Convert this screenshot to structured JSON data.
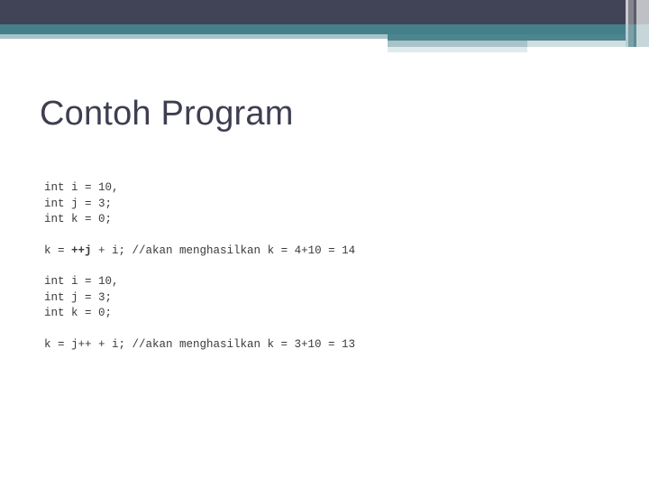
{
  "slide": {
    "title": "Contoh Program",
    "theme": {
      "dark_band": "#414357",
      "teal_band": "#43808a",
      "pale_band": "#a9c3c8",
      "faint_band": "#dfeaec",
      "title_color": "#3d3f51",
      "code_color": "#3a3a3a",
      "background": "#ffffff"
    }
  },
  "code": {
    "groups": [
      {
        "name": "declaration-block-1",
        "lines": [
          {
            "pre": "int i = 10,",
            "bold": "",
            "post": ""
          },
          {
            "pre": "int j = 3;",
            "bold": "",
            "post": ""
          },
          {
            "pre": "int k = 0;",
            "bold": "",
            "post": ""
          }
        ]
      },
      {
        "name": "pre-increment-statement",
        "lines": [
          {
            "pre": "k = ",
            "bold": "++j",
            "post": " + i; //akan menghasilkan k = 4+10 = 14"
          }
        ]
      },
      {
        "name": "declaration-block-2",
        "lines": [
          {
            "pre": "int i = 10,",
            "bold": "",
            "post": ""
          },
          {
            "pre": "int j = 3;",
            "bold": "",
            "post": ""
          },
          {
            "pre": "int k = 0;",
            "bold": "",
            "post": ""
          }
        ]
      },
      {
        "name": "post-increment-statement",
        "lines": [
          {
            "pre": "k = j++ + i; //akan menghasilkan k = 3+10 = 13",
            "bold": "",
            "post": ""
          }
        ]
      }
    ]
  }
}
